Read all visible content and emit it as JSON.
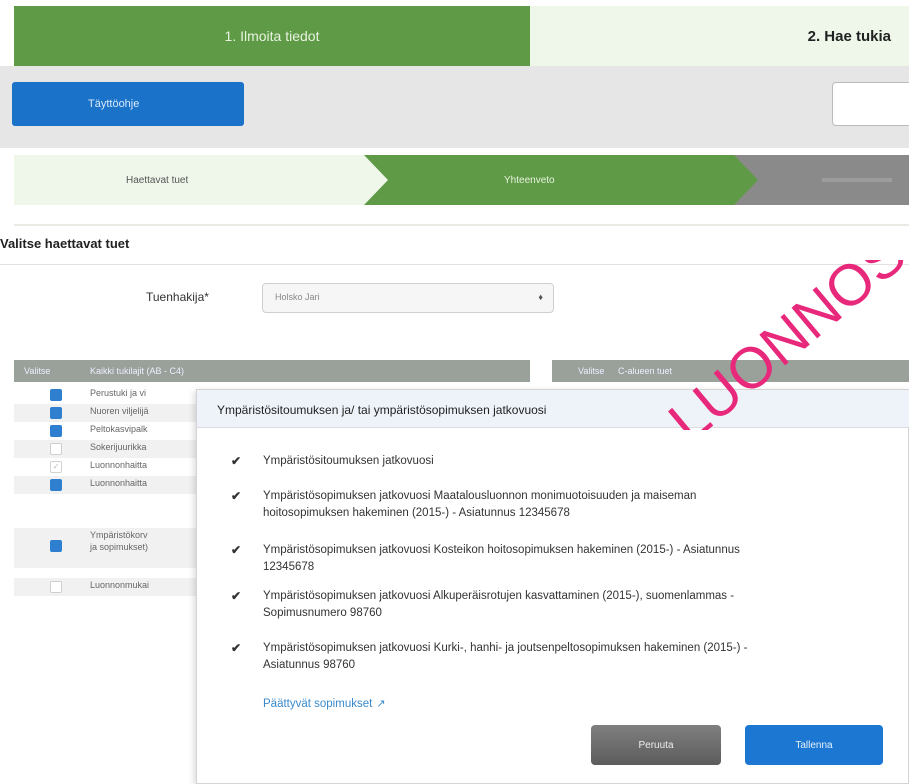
{
  "steps": {
    "step1": "1. Ilmoita tiedot",
    "step2": "2. Hae tukia"
  },
  "toolbar": {
    "help_label": "Täyttöohje"
  },
  "substeps": {
    "sub1": "Haettavat tuet",
    "sub2": "Yhteenveto"
  },
  "section": {
    "title": "Valitse haettavat tuet"
  },
  "applicant": {
    "label": "Tuenhakija*",
    "value": "Holsko Jari"
  },
  "table": {
    "col_select": "Valitse",
    "col_all": "Kaikki tukilajit (AB - C4)",
    "col_select2": "Valitse",
    "col_c": "C-alueen tuet",
    "rows": [
      {
        "text": "Perustuki ja vi",
        "state": "on"
      },
      {
        "text": "Nuoren viljelijä",
        "state": "on"
      },
      {
        "text": "Peltokasvipalk",
        "state": "on"
      },
      {
        "text": "Sokerijuurikka",
        "state": "off"
      },
      {
        "text": "Luonnonhaitta",
        "state": "offtick"
      },
      {
        "text": "Luonnonhaitta",
        "state": "on"
      },
      {
        "text": "Ympäristökorv",
        "text2": "ja sopimukset)",
        "state": "on"
      },
      {
        "text": "Luonnonmukai",
        "state": "off"
      }
    ]
  },
  "modal": {
    "title": "Ympäristösitoumuksen ja/ tai ympäristösopimuksen jatkovuosi",
    "options": [
      {
        "text": "Ympäristösitoumuksen jatkovuosi"
      },
      {
        "text": "Ympäristösopimuksen jatkovuosi Maatalousluonnon monimuotoisuuden ja maiseman hoitosopimuksen hakeminen (2015-) - Asiatunnus 12345678"
      },
      {
        "text": "Ympäristösopimuksen jatkovuosi Kosteikon hoitosopimuksen hakeminen (2015-) - Asiatunnus 12345678"
      },
      {
        "text": "Ympäristösopimuksen jatkovuosi Alkuperäisrotujen kasvattaminen (2015-), suomenlammas - Sopimusnumero 98760"
      },
      {
        "text": "Ympäristösopimuksen jatkovuosi Kurki-, hanhi- ja joutsenpeltosopimuksen hakeminen (2015-) - Asiatunnus 98760"
      }
    ],
    "link": "Päättyvät sopimukset",
    "cancel": "Peruuta",
    "save": "Tallenna"
  },
  "watermark": {
    "text": "LUONNOS",
    "color": "#e8287a"
  },
  "colors": {
    "green": "#5f9a46",
    "light_green": "#eef7ea",
    "blue": "#1b77d2"
  }
}
